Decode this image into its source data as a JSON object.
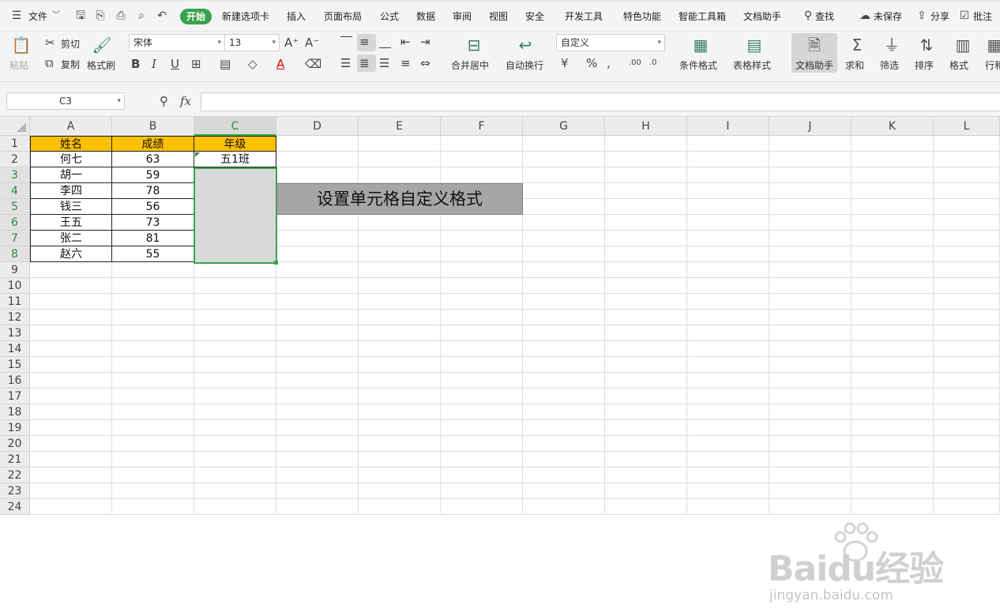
{
  "menubar": {
    "file_label": "文件",
    "start_tab": "开始",
    "tabs": [
      "新建选项卡",
      "插入",
      "页面布局",
      "公式",
      "数据",
      "审阅",
      "视图",
      "安全",
      "开发工具",
      "特色功能",
      "智能工具箱",
      "文档助手"
    ],
    "search_label": "查找",
    "unsaved_label": "未保存",
    "share_label": "分享",
    "comment_label": "批注"
  },
  "ribbon": {
    "paste": "粘贴",
    "cut": "剪切",
    "copy": "复制",
    "format_painter": "格式刷",
    "font_name": "宋体",
    "font_size": "13",
    "merge_center": "合并居中",
    "wrap_text": "自动换行",
    "number_format": "自定义",
    "conditional_format": "条件格式",
    "table_style": "表格样式",
    "doc_helper": "文档助手",
    "sum": "求和",
    "filter": "筛选",
    "sort": "排序",
    "format": "格式",
    "row_col": "行和"
  },
  "formula_bar": {
    "cell_ref": "C3",
    "fx_label": "fx",
    "formula": ""
  },
  "sheet": {
    "columns": [
      "A",
      "B",
      "C",
      "D",
      "E",
      "F",
      "G",
      "H",
      "I",
      "J",
      "K",
      "L"
    ],
    "rows": [
      "1",
      "2",
      "3",
      "4",
      "5",
      "6",
      "7",
      "8",
      "9",
      "10",
      "11",
      "12",
      "13",
      "14",
      "15",
      "16",
      "17",
      "18",
      "19",
      "20",
      "21",
      "22",
      "23",
      "24"
    ],
    "headers": [
      "姓名",
      "成绩",
      "年级"
    ],
    "data": [
      [
        "何七",
        "63",
        "五1班"
      ],
      [
        "胡一",
        "59",
        ""
      ],
      [
        "李四",
        "78",
        ""
      ],
      [
        "钱三",
        "56",
        ""
      ],
      [
        "王五",
        "73",
        ""
      ],
      [
        "张二",
        "81",
        ""
      ],
      [
        "赵六",
        "55",
        ""
      ]
    ],
    "callout_text": "设置单元格自定义格式",
    "colors": {
      "header_fill": "#ffc000",
      "selection_border": "#3aa34a",
      "callout_fill": "#a6a6a6"
    }
  },
  "watermark": {
    "line1": "Baidu经验",
    "line2": "jingyan.baidu.com"
  }
}
